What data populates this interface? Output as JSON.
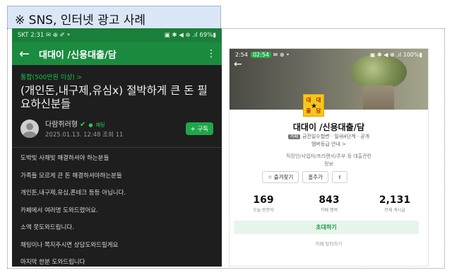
{
  "caption": "※ SNS, 인터넷 광고 사례",
  "left_phone": {
    "status_bar": {
      "left": "SKT 2:31 ✉ ⊕ ✐ •",
      "right": "▣ ✱ ◀ ⊕ .ıl 69%▮"
    },
    "app_title": "대대이 /신용대출/담",
    "board_name": "통합(500만원 이상) >",
    "post_title": "(개인돈,내구제,유심x) 절박하게 큰 돈 필요하신분들",
    "author": {
      "name": "다람쥐러형",
      "chat_label": "채팅",
      "meta": "2025.01.13. 12:48 조회 11"
    },
    "subscribe_label": "+ 구독",
    "body_lines": [
      "도박빚 사채빚 해결하셔야 하는분들",
      "가족들 모르게 큰 돈 해결하셔야하는분들",
      "개인돈,내구제,유심,폰테크 등등 아닙니다.",
      "카페에서 여러명 도와드렸어요.",
      "소액 못도와드립니다.",
      "채팅이나 쪽지주시면 상담도와드릴게요",
      "마지막 한분 도와드립니다"
    ]
  },
  "right_phone": {
    "status_bar": {
      "left": "2:54",
      "call": "02:54",
      "extra": "✉ ⊕ •",
      "right": "▣ ✱ ◀ ⊕ .ıl 100%▮"
    },
    "logo_chars": [
      "대",
      "대",
      "출",
      "담"
    ],
    "cafe_name": "대대이 /신용대출/담",
    "cafe_tag": "카페",
    "cafe_sub": "금전일수협변 · 일새4단계 · 공개",
    "cafe_sub2": "멤버등급 안내 >",
    "cafe_desc_1": "직장인/사업자/프리랜서/주부 등 대출관련",
    "cafe_desc_2": "정보",
    "buttons": {
      "favorite": "즐겨찾기",
      "home": "홈추가",
      "share": "⇪"
    },
    "stats": [
      {
        "num": "169",
        "label": "오늘 방문자"
      },
      {
        "num": "843",
        "label": "카페 멤버"
      },
      {
        "num": "2,131",
        "label": "전체 게시글"
      }
    ],
    "invite_label": "초대하기",
    "join_label": "카페 탈퇴하기"
  }
}
